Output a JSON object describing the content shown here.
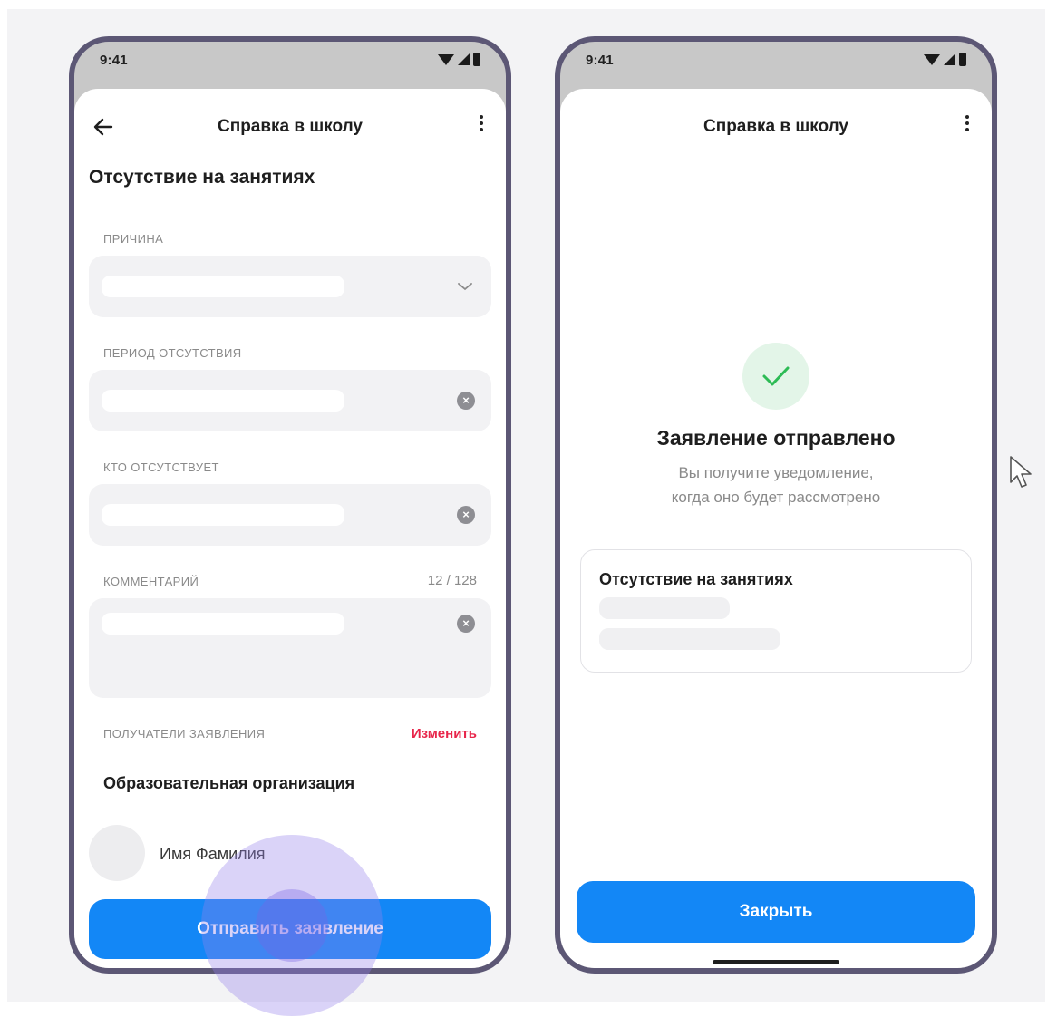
{
  "left_screen": {
    "status": {
      "time": "9:41"
    },
    "header": {
      "title": "Справка в школу"
    },
    "page_title": "Отсутствие на занятиях",
    "fields": {
      "reason_label": "ПРИЧИНА",
      "period_label": "ПЕРИОД ОТСУТСТВИЯ",
      "who_label": "КТО ОТСУТСТВУЕТ",
      "comment_label": "КОММЕНТАРИЙ",
      "comment_counter": "12 / 128"
    },
    "recipients": {
      "label": "ПОЛУЧАТЕЛИ ЗАЯВЛЕНИЯ",
      "change_link": "Изменить",
      "organization": "Образовательная организация",
      "person_name": "Имя Фамилия"
    },
    "submit_button": "Отправить заявление"
  },
  "right_screen": {
    "status": {
      "time": "9:41"
    },
    "header": {
      "title": "Справка в школу"
    },
    "success": {
      "title": "Заявление отправлено",
      "subtitle_line1": "Вы получите уведомление,",
      "subtitle_line2": "когда оно будет рассмотрено"
    },
    "card": {
      "title": "Отсутствие на занятиях"
    },
    "close_button": "Закрыть"
  },
  "colors": {
    "accent": "#1387f6",
    "link_red": "#e8254a",
    "success_green": "#2dbb55",
    "phone_frame": "#5c5775"
  },
  "icons": [
    "back-arrow-icon",
    "more-vertical-icon",
    "chevron-down-icon",
    "clear-icon",
    "wifi-icon",
    "signal-icon",
    "battery-icon",
    "check-icon",
    "cursor-icon"
  ]
}
